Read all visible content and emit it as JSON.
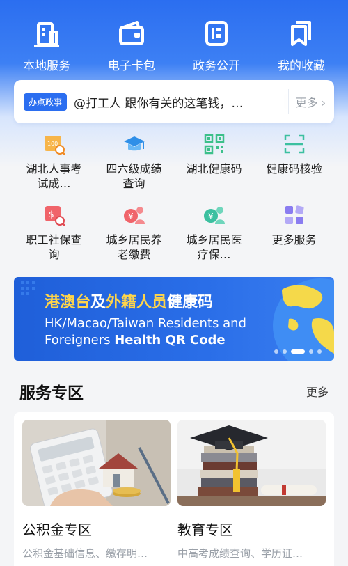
{
  "topnav": [
    {
      "label": "本地服务",
      "icon": "building-icon"
    },
    {
      "label": "电子卡包",
      "icon": "wallet-icon"
    },
    {
      "label": "政务公开",
      "icon": "document-icon"
    },
    {
      "label": "我的收藏",
      "icon": "bookmark-icon"
    }
  ],
  "notice": {
    "badge": "办点政事",
    "text": "@打工人 跟你有关的这笔钱，…",
    "more": "更多"
  },
  "services": [
    {
      "label": "湖北人事考试成…",
      "icon": "exam-score-icon",
      "color": "#f5a623"
    },
    {
      "label": "四六级成绩查询",
      "icon": "graduation-cap-icon",
      "color": "#3aa0f0"
    },
    {
      "label": "湖北健康码",
      "icon": "qr-code-icon",
      "color": "#3cc08a"
    },
    {
      "label": "健康码核验",
      "icon": "scan-icon",
      "color": "#3cc0a0"
    },
    {
      "label": "职工社保查询",
      "icon": "social-security-icon",
      "color": "#f0646a"
    },
    {
      "label": "城乡居民养老缴费",
      "icon": "pension-icon",
      "color": "#f0646a"
    },
    {
      "label": "城乡居民医疗保…",
      "icon": "medical-icon",
      "color": "#3cc0a0"
    },
    {
      "label": "更多服务",
      "icon": "more-apps-icon",
      "color": "#8a7cf0"
    }
  ],
  "banner": {
    "title_hl1": "港澳台",
    "title_mid": "及",
    "title_hl2": "外籍人员",
    "title_tail": "健康码",
    "en_line1": "HK/Macao/Taiwan Residents and",
    "en_line2_prefix": "Foreigners ",
    "en_line2_bold": "Health QR Code"
  },
  "section": {
    "title": "服务专区",
    "more": "更多"
  },
  "cards": [
    {
      "title": "公积金专区",
      "subtitle": "公积金基础信息、缴存明…"
    },
    {
      "title": "教育专区",
      "subtitle": "中高考成绩查询、学历证…"
    }
  ],
  "colors": {
    "brand": "#2b6ef0",
    "banner_highlight": "#ffd54a"
  }
}
